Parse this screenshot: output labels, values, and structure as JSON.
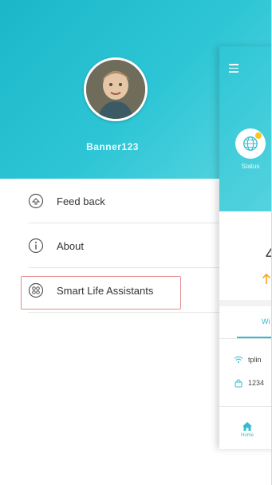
{
  "drawer": {
    "username": "Banner123"
  },
  "menu": {
    "items": [
      {
        "label": "Feed back",
        "icon": "feedback-icon"
      },
      {
        "label": "About",
        "icon": "info-icon"
      },
      {
        "label": "Smart Life Assistants",
        "icon": "smart-life-icon"
      }
    ]
  },
  "app_preview": {
    "status_label": "Status",
    "metric_value": "4",
    "tab_label": "Wi",
    "network_rows": [
      {
        "icon": "wifi-icon",
        "text": "tplin"
      },
      {
        "icon": "lock-icon",
        "text": "1234"
      }
    ],
    "bottom_tab_label": "Home"
  },
  "colors": {
    "header_gradient_start": "#1bb7c9",
    "header_gradient_end": "#5ad5df",
    "highlight_outline": "#e58c8f",
    "accent": "#34bccc",
    "status_dot": "#ffc31a",
    "arrow": "#f5a623"
  }
}
